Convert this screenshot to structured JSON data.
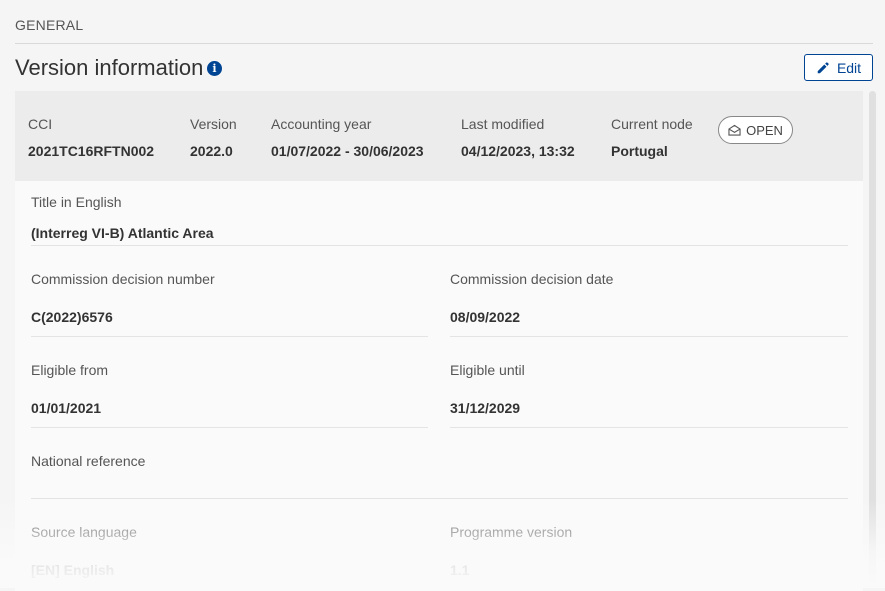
{
  "section": {
    "label": "GENERAL"
  },
  "header": {
    "title": "Version information",
    "edit_label": "Edit"
  },
  "summary": {
    "cci": {
      "label": "CCI",
      "value": "2021TC16RFTN002"
    },
    "version": {
      "label": "Version",
      "value": "2022.0"
    },
    "accounting_year": {
      "label": "Accounting year",
      "value": "01/07/2022 - 30/06/2023"
    },
    "last_modified": {
      "label": "Last modified",
      "value": "04/12/2023, 13:32"
    },
    "current_node": {
      "label": "Current node",
      "value": "Portugal"
    },
    "status": {
      "label": "OPEN"
    }
  },
  "fields": {
    "title_english": {
      "label": "Title in English",
      "value": "(Interreg VI-B) Atlantic Area"
    },
    "commission_decision_number": {
      "label": "Commission decision number",
      "value": "C(2022)6576"
    },
    "commission_decision_date": {
      "label": "Commission decision date",
      "value": "08/09/2022"
    },
    "eligible_from": {
      "label": "Eligible from",
      "value": "01/01/2021"
    },
    "eligible_until": {
      "label": "Eligible until",
      "value": "31/12/2029"
    },
    "national_reference": {
      "label": "National reference",
      "value": ""
    },
    "source_language": {
      "label": "Source language",
      "value": "[EN] English"
    },
    "programme_version": {
      "label": "Programme version",
      "value": "1.1"
    }
  },
  "colors": {
    "accent": "#004494",
    "summary_bg": "#ececec",
    "card_bg": "#fafafa"
  }
}
